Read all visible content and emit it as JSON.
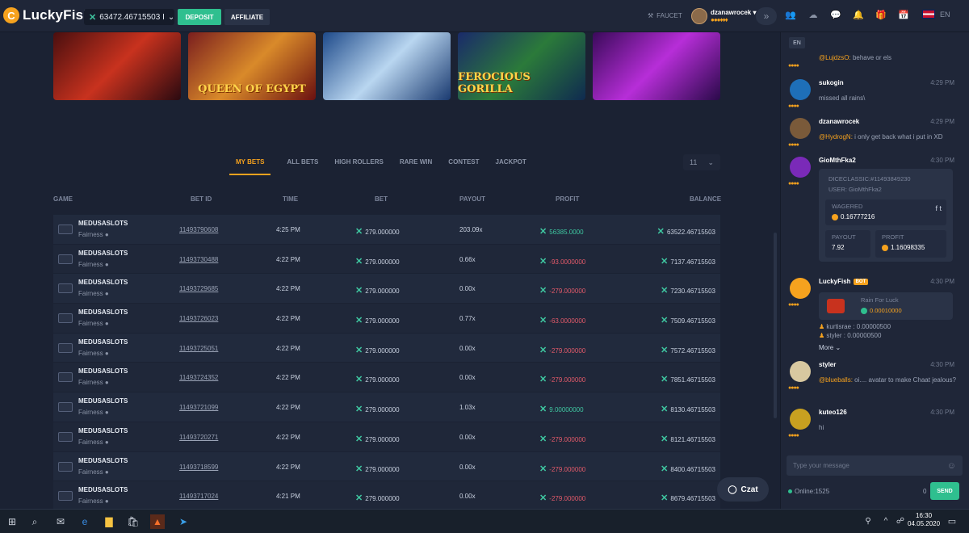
{
  "header": {
    "logo": "LuckyFish",
    "balance": "63472.46715503 I",
    "deposit": "DEPOSIT",
    "affiliate": "AFFILIATE",
    "faucet": "FAUCET",
    "username": "dzanawrocek",
    "language": "EN"
  },
  "games": [
    {
      "title": "",
      "bg": "linear-gradient(135deg,#4a0f0f,#c8321e 50%,#2a0a10)"
    },
    {
      "title": "QUEEN OF EGYPT",
      "bg": "linear-gradient(135deg,#7a1e1e,#d98a2a 50%,#6a1010)"
    },
    {
      "title": "",
      "bg": "linear-gradient(135deg,#1e4a8a,#b9d6f0 50%,#1a3a70)"
    },
    {
      "title": "FEROCIOUS GORILLA",
      "bg": "linear-gradient(135deg,#1a2a6a,#2b7a3a 50%,#0f2a50)"
    },
    {
      "title": "",
      "bg": "linear-gradient(135deg,#3a0a5a,#b72ed8 50%,#2a0a4a)"
    }
  ],
  "bet_tabs": [
    "MY BETS",
    "ALL BETS",
    "HIGH ROLLERS",
    "RARE WIN",
    "CONTEST",
    "JACKPOT"
  ],
  "count": "11",
  "table": {
    "headers": {
      "game": "GAME",
      "bet_id": "BET ID",
      "time": "TIME",
      "bet": "BET",
      "payout": "PAYOUT",
      "profit": "PROFIT",
      "balance": "BALANCE"
    },
    "rows": [
      {
        "game": "MEDUSASLOTS",
        "fair": "Fairness",
        "id": "11493790608",
        "time": "4:25 PM",
        "bet": "279.000000",
        "payout": "203.09x",
        "profit": "56385.0000",
        "balance": "63522.46715503",
        "win": true
      },
      {
        "game": "MEDUSASLOTS",
        "fair": "Fairness",
        "id": "11493730488",
        "time": "4:22 PM",
        "bet": "279.000000",
        "payout": "0.66x",
        "profit": "-93.0000000",
        "balance": "7137.46715503",
        "win": false
      },
      {
        "game": "MEDUSASLOTS",
        "fair": "Fairness",
        "id": "11493729685",
        "time": "4:22 PM",
        "bet": "279.000000",
        "payout": "0.00x",
        "profit": "-279.000000",
        "balance": "7230.46715503",
        "win": false
      },
      {
        "game": "MEDUSASLOTS",
        "fair": "Fairness",
        "id": "11493726023",
        "time": "4:22 PM",
        "bet": "279.000000",
        "payout": "0.77x",
        "profit": "-63.0000000",
        "balance": "7509.46715503",
        "win": false
      },
      {
        "game": "MEDUSASLOTS",
        "fair": "Fairness",
        "id": "11493725051",
        "time": "4:22 PM",
        "bet": "279.000000",
        "payout": "0.00x",
        "profit": "-279.000000",
        "balance": "7572.46715503",
        "win": false
      },
      {
        "game": "MEDUSASLOTS",
        "fair": "Fairness",
        "id": "11493724352",
        "time": "4:22 PM",
        "bet": "279.000000",
        "payout": "0.00x",
        "profit": "-279.000000",
        "balance": "7851.46715503",
        "win": false
      },
      {
        "game": "MEDUSASLOTS",
        "fair": "Fairness",
        "id": "11493721099",
        "time": "4:22 PM",
        "bet": "279.000000",
        "payout": "1.03x",
        "profit": "9.00000000",
        "balance": "8130.46715503",
        "win": true
      },
      {
        "game": "MEDUSASLOTS",
        "fair": "Fairness",
        "id": "11493720271",
        "time": "4:22 PM",
        "bet": "279.000000",
        "payout": "0.00x",
        "profit": "-279.000000",
        "balance": "8121.46715503",
        "win": false
      },
      {
        "game": "MEDUSASLOTS",
        "fair": "Fairness",
        "id": "11493718599",
        "time": "4:22 PM",
        "bet": "279.000000",
        "payout": "0.00x",
        "profit": "-279.000000",
        "balance": "8400.46715503",
        "win": false
      },
      {
        "game": "MEDUSASLOTS",
        "fair": "Fairness",
        "id": "11493717024",
        "time": "4:21 PM",
        "bet": "279.000000",
        "payout": "0.00x",
        "profit": "-279.000000",
        "balance": "8679.46715503",
        "win": false
      }
    ]
  },
  "czat": "Czat",
  "chat": {
    "lang": "EN",
    "messages": {
      "m0": {
        "mention": "@LujdzsO:",
        "text": "behave or els"
      },
      "m1": {
        "name": "sukogin",
        "time": "4:29 PM",
        "text": "missed all rains\\"
      },
      "m2": {
        "name": "dzanawrocek",
        "time": "4:29 PM",
        "mention": "@HydrogN:",
        "text": "i only get back what i put in XD"
      },
      "m3": {
        "name": "GioMthFka2",
        "time": "4:30 PM"
      },
      "m4": {
        "name": "LuckyFish",
        "badge": "BOT",
        "time": "4:30 PM",
        "more": "More"
      },
      "m5": {
        "name": "styler",
        "time": "4:30 PM",
        "mention": "@blueballs:",
        "text": "oi.... avatar to make Chaat jealous?"
      },
      "m6": {
        "name": "kuteo126",
        "time": "4:30 PM",
        "text": "hi"
      }
    },
    "dice": {
      "title": "DICECLASSIC:#11493849230",
      "user": "USER: GioMthFka2",
      "wagered_label": "WAGERED",
      "wagered": "0.16777216",
      "payout_label": "PAYOUT",
      "payout": "7.92",
      "profit_label": "PROFIT",
      "profit": "1.16098335"
    },
    "rain": {
      "title": "Rain For Luck",
      "amount": "0.00010000",
      "r1": "kurtisrae : 0.00000500",
      "r2": "styler : 0.00000500"
    },
    "input_placeholder": "Type your message",
    "online": "Online:1525",
    "zero": "0",
    "send": "SEND"
  },
  "taskbar": {
    "time": "16:30",
    "date": "04.05.2020"
  }
}
